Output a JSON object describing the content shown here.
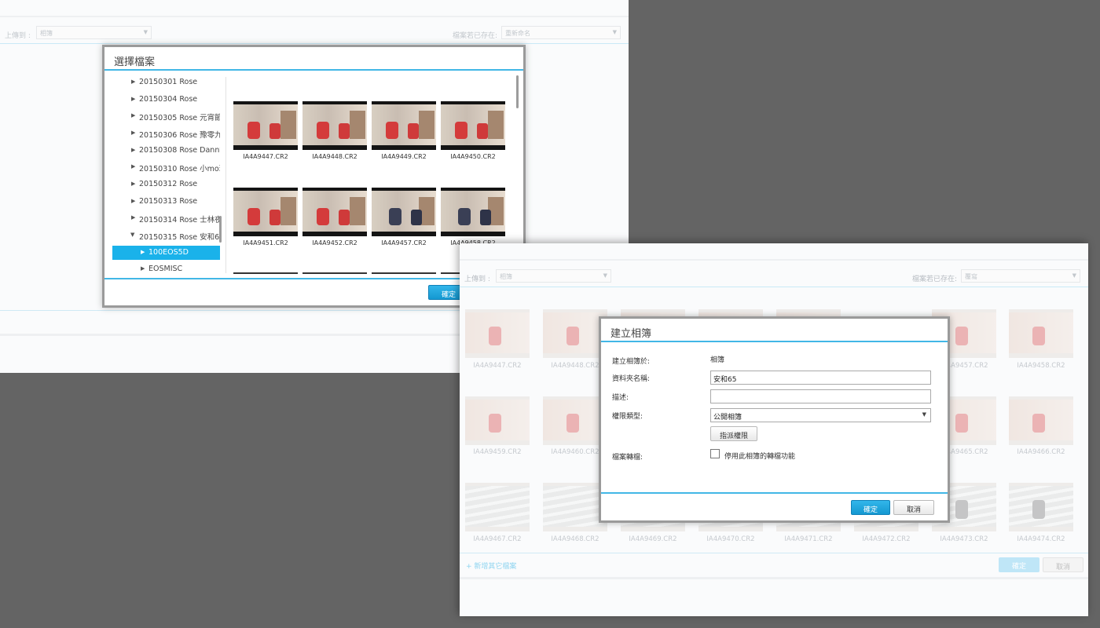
{
  "panel1": {
    "upload_label": "上傳到 :",
    "upload_value": "相簿",
    "exists_label": "檔案若已存在:",
    "exists_value": "重新命名"
  },
  "dialog1": {
    "title": "選擇檔案",
    "folders": [
      {
        "label": "20150301 Rose",
        "expanded": false
      },
      {
        "label": "20150304 Rose",
        "expanded": false
      },
      {
        "label": "20150305 Rose 元宵節",
        "expanded": false
      },
      {
        "label": "20150306 Rose 豫零九",
        "expanded": false
      },
      {
        "label": "20150308 Rose Danny",
        "expanded": false
      },
      {
        "label": "20150310 Rose 小mo玩",
        "expanded": false
      },
      {
        "label": "20150312 Rose",
        "expanded": false
      },
      {
        "label": "20150313 Rose",
        "expanded": false
      },
      {
        "label": "20150314 Rose 士林夜",
        "expanded": false
      },
      {
        "label": "20150315 Rose 安和65",
        "expanded": true
      },
      {
        "label": "100EOS5D",
        "selected": true
      },
      {
        "label": "EOSMISC",
        "selected": false
      }
    ],
    "files": [
      "IA4A9447.CR2",
      "IA4A9448.CR2",
      "IA4A9449.CR2",
      "IA4A9450.CR2",
      "IA4A9451.CR2",
      "IA4A9452.CR2",
      "IA4A9457.CR2",
      "IA4A9458.CR2"
    ],
    "ok_label": "確定"
  },
  "panel2": {
    "upload_label": "上傳到 :",
    "upload_value": "相簿",
    "exists_label": "檔案若已存在:",
    "exists_value": "覆寫",
    "files_row1": [
      "IA4A9447.CR2",
      "IA4A9448.CR2",
      "",
      "",
      "",
      "IA4A9457.CR2",
      "IA4A9458.CR2"
    ],
    "files_row2": [
      "IA4A9459.CR2",
      "IA4A9460.CR2",
      "",
      "",
      "",
      "IA4A9465.CR2",
      "IA4A9466.CR2"
    ],
    "files_row3": [
      "IA4A9467.CR2",
      "IA4A9468.CR2",
      "IA4A9469.CR2",
      "IA4A9470.CR2",
      "IA4A9471.CR2",
      "IA4A9472.CR2",
      "IA4A9473.CR2",
      "IA4A9474.CR2"
    ],
    "add_existing": "+ 新增其它檔案",
    "ok_label": "確定",
    "cancel_label": "取消"
  },
  "dialog2": {
    "title": "建立相簿",
    "create_in_label": "建立相簿於:",
    "create_in_value": "相簿",
    "folder_name_label": "資料夾名稱:",
    "folder_name_value": "安和65",
    "description_label": "描述:",
    "description_value": "",
    "permission_type_label": "權限類型:",
    "permission_type_value": "公開相簿",
    "assign_permission_button": "指派權限",
    "file_conversion_label": "檔案轉檔:",
    "disable_conversion_checkbox": "停用此相簿的轉檔功能",
    "disable_conversion_checked": false,
    "ok_label": "確定",
    "cancel_label": "取消"
  },
  "colors": {
    "accent": "#1ab2ea",
    "accent_line": "#42b7e6",
    "backdrop": "#646464"
  }
}
